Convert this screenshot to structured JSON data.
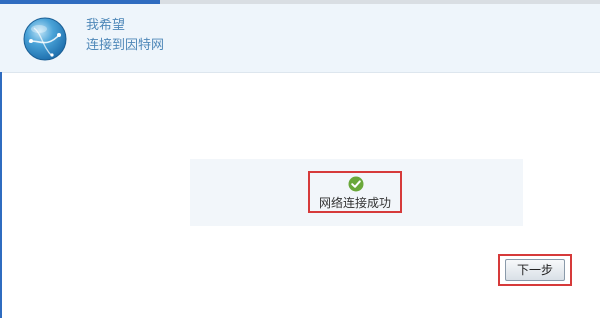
{
  "header": {
    "line1": "我希望",
    "line2": "连接到因特网"
  },
  "status": {
    "message": "网络连接成功",
    "icon": "check-circle-icon",
    "icon_color": "#6aa83a"
  },
  "footer": {
    "next_label": "下一步"
  },
  "colors": {
    "accent": "#2f6cc0",
    "highlight_border": "#d63a3a",
    "header_text": "#4f88b8"
  }
}
